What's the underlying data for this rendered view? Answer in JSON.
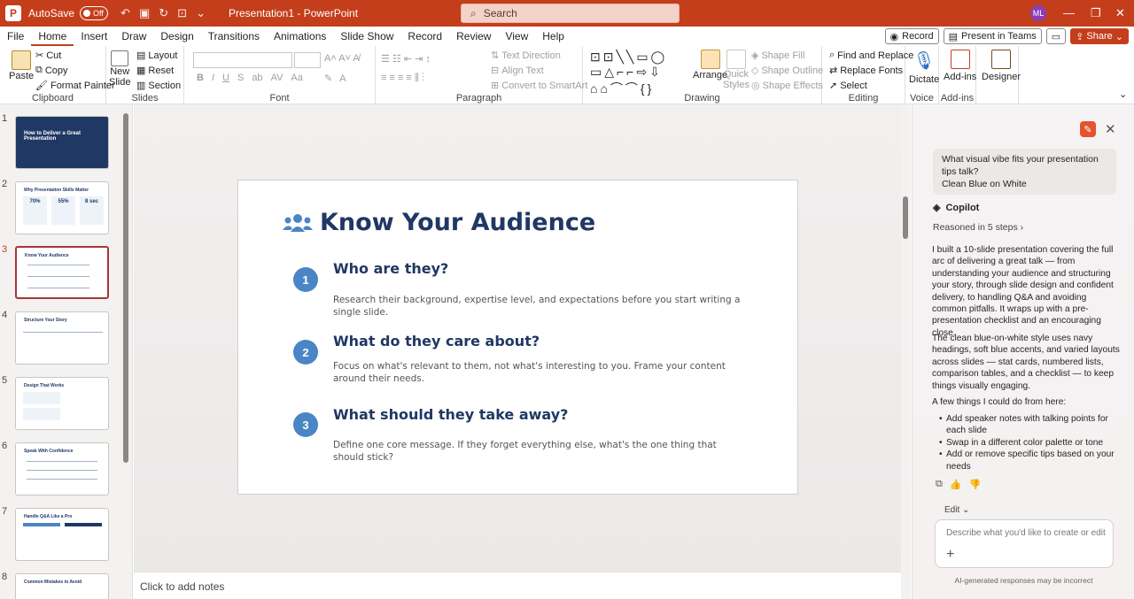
{
  "titlebar": {
    "autosave_label": "AutoSave",
    "autosave_state": "Off",
    "doc_title": "Presentation1 - PowerPoint",
    "search_placeholder": "Search",
    "avatar_initials": "ML"
  },
  "menu": {
    "tabs": [
      "File",
      "Home",
      "Insert",
      "Draw",
      "Design",
      "Transitions",
      "Animations",
      "Slide Show",
      "Record",
      "Review",
      "View",
      "Help"
    ],
    "active": "Home",
    "record": "Record",
    "present_teams": "Present in Teams",
    "share": "Share"
  },
  "ribbon": {
    "clipboard": {
      "paste": "Paste",
      "cut": "Cut",
      "copy": "Copy",
      "format_painter": "Format Painter",
      "label": "Clipboard"
    },
    "slides": {
      "new_slide": "New",
      "new_slide2": "Slide",
      "layout": "Layout",
      "reset": "Reset",
      "section": "Section",
      "label": "Slides"
    },
    "font": {
      "label": "Font"
    },
    "paragraph": {
      "text_direction": "Text Direction",
      "align_text": "Align Text",
      "convert_smartart": "Convert to SmartArt",
      "label": "Paragraph"
    },
    "drawing": {
      "arrange": "Arrange",
      "quick_styles": "Quick",
      "quick_styles2": "Styles",
      "shape_fill": "Shape Fill",
      "shape_outline": "Shape Outline",
      "shape_effects": "Shape Effects",
      "label": "Drawing"
    },
    "editing": {
      "find_replace": "Find and Replace",
      "replace_fonts": "Replace Fonts",
      "select": "Select",
      "label": "Editing"
    },
    "voice": {
      "dictate": "Dictate",
      "label": "Voice"
    },
    "addins": {
      "addins": "Add-ins",
      "label": "Add-ins"
    },
    "designer": {
      "designer": "Designer"
    }
  },
  "thumbnails": [
    {
      "num": "1",
      "title": "How to Deliver a Great Presentation"
    },
    {
      "num": "2",
      "title": "Why Presentation Skills Matter",
      "stats": [
        "70%",
        "55%",
        "8 sec"
      ]
    },
    {
      "num": "3",
      "title": "Know Your Audience"
    },
    {
      "num": "4",
      "title": "Structure Your Story"
    },
    {
      "num": "5",
      "title": "Design That Works"
    },
    {
      "num": "6",
      "title": "Speak With Confidence"
    },
    {
      "num": "7",
      "title": "Handle Q&A Like a Pro"
    },
    {
      "num": "8",
      "title": "Common Mistakes to Avoid"
    }
  ],
  "slide": {
    "title": "Know Your Audience",
    "items": [
      {
        "num": "1",
        "heading": "Who are they?",
        "body": "Research their background, expertise level, and expectations before you start writing a single slide."
      },
      {
        "num": "2",
        "heading": "What do they care about?",
        "body": "Focus on what's relevant to them, not what's interesting to you. Frame your content around their needs."
      },
      {
        "num": "3",
        "heading": "What should they take away?",
        "body": "Define one core message. If they forget everything else, what's the one thing that should stick?"
      }
    ]
  },
  "notes_placeholder": "Click to add notes",
  "copilot": {
    "user_msg_1": "What visual vibe fits your presentation tips talk?",
    "user_msg_2": "Clean Blue on White",
    "name": "Copilot",
    "reasoned": "Reasoned in 5 steps",
    "para1": "I built a 10-slide presentation covering the full arc of delivering a great talk — from understanding your audience and structuring your story, through slide design and confident delivery, to handling Q&A and avoiding common pitfalls. It wraps up with a pre-presentation checklist and an encouraging close.",
    "para2": "The clean blue-on-white style uses navy headings, soft blue accents, and varied layouts across slides — stat cards, numbered lists, comparison tables, and a checklist — to keep things visually engaging.",
    "para3": "A few things I could do from here:",
    "options": [
      "Add speaker notes with talking points for each slide",
      "Swap in a different color palette or tone",
      "Add or remove specific tips based on your needs"
    ],
    "edit_label": "Edit",
    "input_placeholder": "Describe what you'd like to create or edit",
    "footer": "AI-generated responses may be incorrect"
  }
}
